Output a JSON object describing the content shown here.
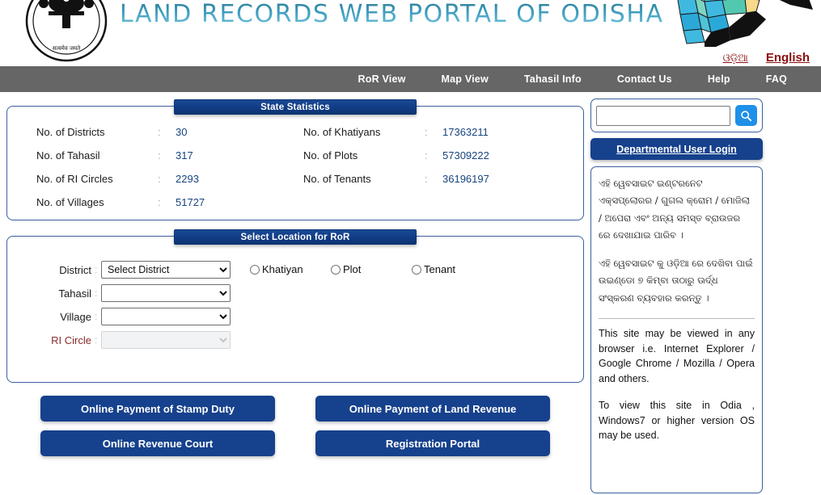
{
  "header": {
    "portal_title": "LAND RECORDS WEB PORTAL OF ODISHA",
    "emblem_alt": "government-emblem",
    "map_alt": "odisha-district-map",
    "languages": [
      {
        "label": "ଓଡ଼ିଆ",
        "active": false
      },
      {
        "label": "English",
        "active": true
      }
    ]
  },
  "nav": {
    "items": [
      {
        "label": "RoR View"
      },
      {
        "label": "Map View"
      },
      {
        "label": "Tahasil Info"
      },
      {
        "label": "Contact Us"
      },
      {
        "label": "Help"
      },
      {
        "label": "FAQ"
      }
    ]
  },
  "state_statistics": {
    "tab_label": "State Statistics",
    "separator": ":",
    "left_column": [
      {
        "label": "No. of Districts",
        "value": "30"
      },
      {
        "label": "No. of Tahasil",
        "value": "317"
      },
      {
        "label": "No. of RI Circles",
        "value": "2293"
      },
      {
        "label": "No. of Villages",
        "value": "51727"
      }
    ],
    "right_column": [
      {
        "label": "No. of Khatiyans",
        "value": "17363211"
      },
      {
        "label": "No. of Plots",
        "value": "57309222"
      },
      {
        "label": "No. of Tenants",
        "value": "36196197"
      }
    ]
  },
  "select_location": {
    "tab_label": "Select Location for RoR",
    "fields": [
      {
        "label": "District",
        "value": "Select District",
        "disabled": false
      },
      {
        "label": "Tahasil",
        "value": "",
        "disabled": false
      },
      {
        "label": "Village",
        "value": "",
        "disabled": false
      },
      {
        "label": "RI Circle",
        "value": "",
        "disabled": true
      }
    ],
    "record_types": [
      {
        "label": "Khatiyan",
        "checked": false
      },
      {
        "label": "Plot",
        "checked": false
      },
      {
        "label": "Tenant",
        "checked": false
      }
    ]
  },
  "action_buttons": [
    {
      "label": "Online Payment of Stamp Duty"
    },
    {
      "label": "Online Payment of Land Revenue"
    },
    {
      "label": "Online Revenue Court"
    },
    {
      "label": "Registration Portal"
    }
  ],
  "sidebar": {
    "search": {
      "placeholder": "",
      "value": "",
      "icon": "search-icon"
    },
    "login_label": "Departmental User Login",
    "notice_odia_1": "ଏହି ୱେବସାଇଟ ଇଣ୍ଟରନେଟ ଏକ୍ସପ୍ଲୋରର / ଗୁଗଲ କ୍ରୋମ / ମୋଜିଲା / ଅପେରା ଏବଂ ଅନ୍ୟ ସମସ୍ତ ବ୍ରାଉଜର ରେ ଦେଖାଯାଇ ପାରିବ ।",
    "notice_odia_2": "ଏହି ୱେବସାଇଟ କୁ ଓଡ଼ିଆ ରେ ଦେଖିବା ପାଇଁ ଉଇଣ୍ଡୋ ୭ କିମ୍ବା ତାଠାରୁ ଊର୍ଦ୍ଧ ସଂସ୍କରଣ ବ୍ୟବହାର କରନ୍ତୁ ।",
    "notice_en_1": "This site may be viewed in any browser i.e. Internet Explorer / Google Chrome / Mozilla / Opera and others.",
    "notice_en_2": "To view this site in Odia , Windows7 or higher version OS may be used."
  },
  "colors": {
    "brand_blue": "#16418c",
    "nav_grey": "#666666",
    "panel_border": "#3a5f9e",
    "value_blue": "#17447e",
    "lang_red": "#8a1010",
    "search_btn": "#1e90e8"
  }
}
